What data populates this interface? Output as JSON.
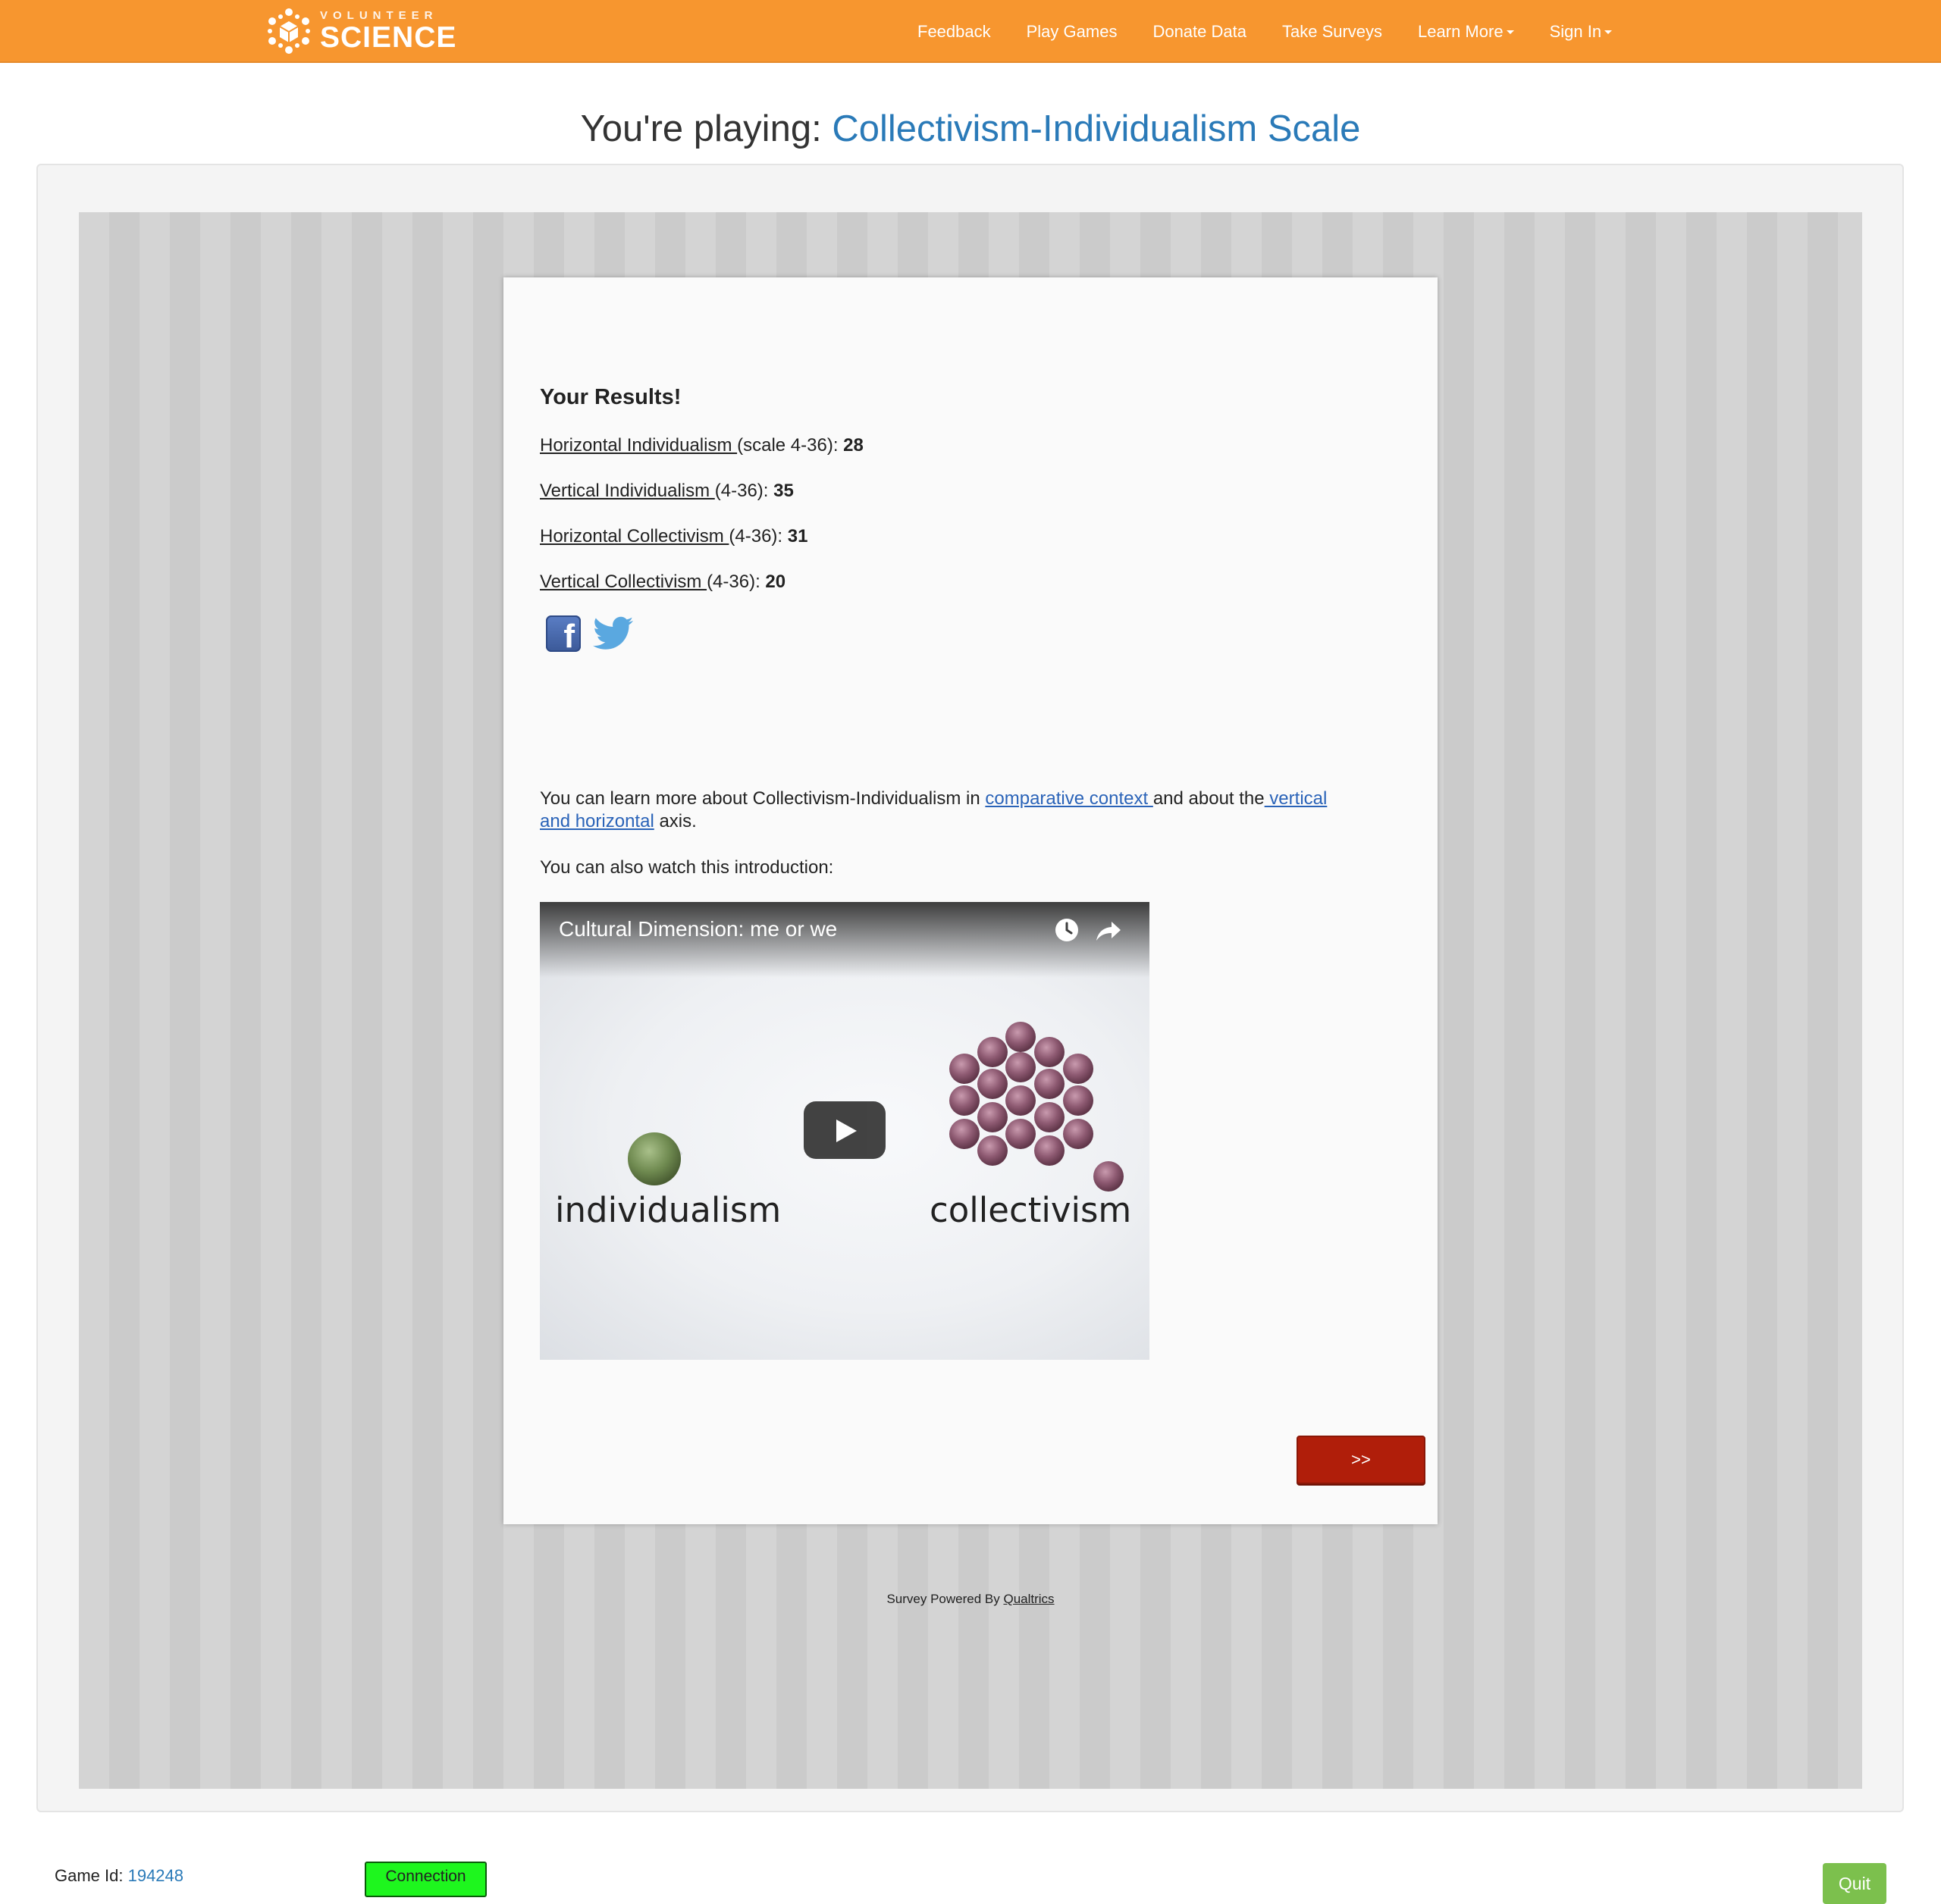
{
  "brand": {
    "small_text": "VOLUNTEER",
    "big_text": "SCIENCE"
  },
  "nav": {
    "feedback": "Feedback",
    "play_games": "Play Games",
    "donate_data": "Donate Data",
    "take_surveys": "Take Surveys",
    "learn_more": "Learn More",
    "sign_in": "Sign In"
  },
  "page": {
    "title_prefix": "You're playing:",
    "game_name": "Collectivism-Individualism Scale"
  },
  "results": {
    "title": "Your Results!",
    "lines": [
      {
        "name": "Horizontal Individualism ",
        "scale": "(scale 4-36): ",
        "value": "28"
      },
      {
        "name": "Vertical Individualism ",
        "scale": "(4-36): ",
        "value": "35"
      },
      {
        "name": "Horizontal Collectivism ",
        "scale": "(4-36): ",
        "value": "31"
      },
      {
        "name": "Vertical Collectivism ",
        "scale": "(4-36): ",
        "value": "20"
      }
    ]
  },
  "social": {
    "facebook_icon": "facebook-icon",
    "twitter_icon": "twitter-icon"
  },
  "learn": {
    "text1": "You can learn more about Collectivism-Individualism in ",
    "link1": "comparative context ",
    "text2": "and about the",
    "link2a": " vertical",
    "link2b": "and horizontal",
    "text3": " axis."
  },
  "watch_text": "You can also watch this introduction:",
  "video": {
    "title": "Cultural Dimension: me or we",
    "word_left": "individualism",
    "word_right": "collectivism"
  },
  "next_button": ">>",
  "powered": {
    "prefix": "Survey Powered By ",
    "link": "Qualtrics"
  },
  "footer": {
    "game_id_label": "Game Id: ",
    "game_id": "194248",
    "connection": "Connection",
    "quit": "Quit"
  },
  "colors": {
    "nav": "#f7962f",
    "accent": "#2a7ab8",
    "next": "#b01e0a",
    "connection": "#1ef61e",
    "quit": "#7cc04d"
  }
}
